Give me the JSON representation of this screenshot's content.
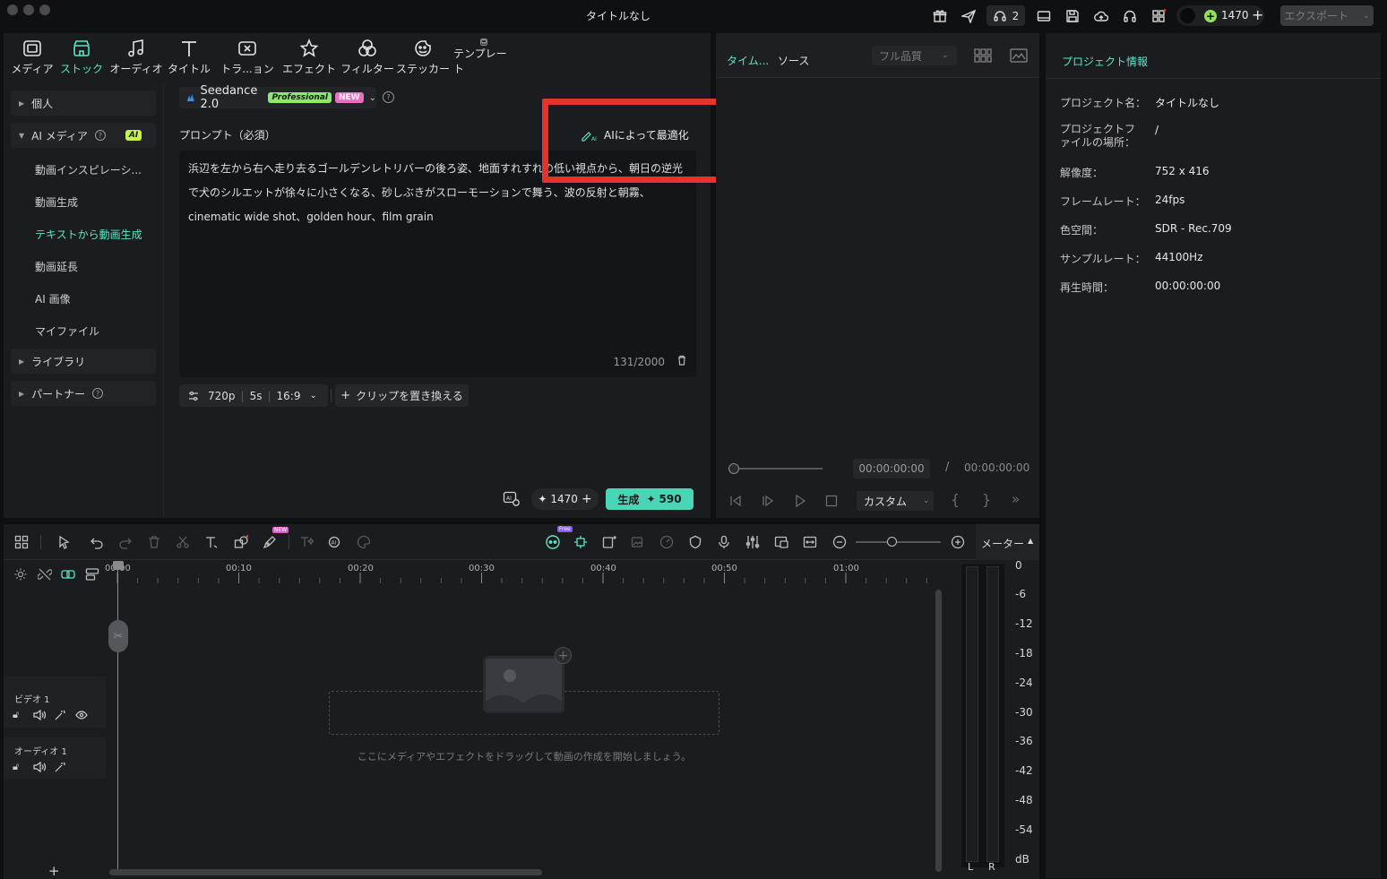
{
  "window": {
    "title": "タイトルなし",
    "notification_count": "2",
    "credits": "1470",
    "export_label": "エクスポート"
  },
  "toolbar": {
    "tools": [
      "メディア",
      "ストック",
      "オーディオ",
      "タイトル",
      "トラ...ョン",
      "エフェクト",
      "フィルター",
      "ステッカー",
      "テンプレート"
    ],
    "active": "ストック"
  },
  "sidebar": {
    "groups": {
      "personal": "個人",
      "ai_media": "AI メディア",
      "library": "ライブラリ",
      "partner": "パートナー"
    },
    "ai_badge": "AI",
    "items": [
      "動画インスピレーシ...",
      "動画生成",
      "テキストから動画生成",
      "動画延長",
      "AI 画像",
      "マイファイル"
    ],
    "active_item": "テキストから動画生成"
  },
  "generator": {
    "model": "Seedance 2.0",
    "badge_pro": "Professional",
    "badge_new": "NEW",
    "prompt_label": "プロンプト（必須）",
    "optimize_label": "AIによって最適化",
    "prompt_text": "浜辺を左から右へ走り去るゴールデンレトリバーの後ろ姿、地面すれすれの低い視点から、朝日の逆光で犬のシルエットが徐々に小さくなる、砂しぶきがスローモーションで舞う、波の反射と朝霧、cinematic wide shot、golden hour、film grain",
    "char_count": "131/2000",
    "resolution": "720p",
    "duration": "5s",
    "ratio": "16:9",
    "replace_clip": "クリップを置き換える",
    "credits": "1470",
    "generate_label": "生成",
    "generate_cost": "590"
  },
  "preview": {
    "tab_timeline": "タイム...",
    "tab_source": "ソース",
    "quality": "フル品質",
    "current_time": "00:00:00:00",
    "separator": "/",
    "total_time": "00:00:00:00",
    "zoom_option": "カスタム"
  },
  "info": {
    "title": "プロジェクト情報",
    "rows": [
      {
        "label": "プロジェクト名：",
        "value": "タイトルなし"
      },
      {
        "label": "プロジェクトファイルの場所：",
        "value": "/"
      },
      {
        "label": "解像度：",
        "value": "752 x 416"
      },
      {
        "label": "フレームレート：",
        "value": "24fps"
      },
      {
        "label": "色空間：",
        "value": "SDR - Rec.709"
      },
      {
        "label": "サンプルレート：",
        "value": "44100Hz"
      },
      {
        "label": "再生時間：",
        "value": "00:00:00:00"
      }
    ]
  },
  "timeline": {
    "meter_label": "メーター",
    "ruler": [
      "00:00",
      "00:10",
      "00:20",
      "00:30",
      "00:40",
      "00:50",
      "01:00"
    ],
    "tracks": {
      "video": "ビデオ 1",
      "audio": "オーディオ 1"
    },
    "drop_hint": "ここにメディアやエフェクトをドラッグして動画の作成を開始しましょう。",
    "badge_free": "Free",
    "badge_new": "NEW",
    "meter_scale": [
      "0",
      "-6",
      "-12",
      "-18",
      "-24",
      "-30",
      "-36",
      "-42",
      "-48",
      "-54",
      "dB"
    ],
    "channels": [
      "L",
      "R"
    ]
  }
}
